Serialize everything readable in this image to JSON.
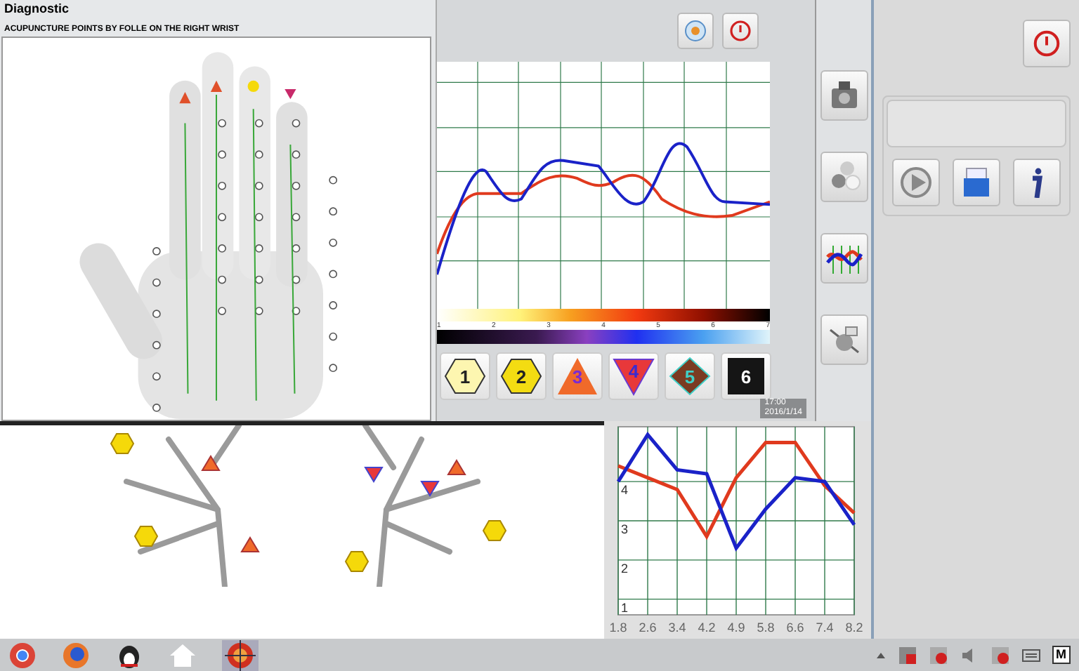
{
  "window": {
    "title": "Diagnostic"
  },
  "hand_panel": {
    "heading": "ACUPUNCTURE POINTS BY FOLLE ON THE RIGHT WRIST"
  },
  "scan_panel": {
    "scale_labels": [
      "1",
      "2",
      "3",
      "4",
      "5",
      "6",
      "7"
    ],
    "markers": [
      {
        "kind": "hexagon",
        "label": "1",
        "color": "#fdf6b0"
      },
      {
        "kind": "hexagon",
        "label": "2",
        "color": "#f3dc12"
      },
      {
        "kind": "triangle",
        "label": "3",
        "color": "#f06a2a"
      },
      {
        "kind": "inverted-triangle",
        "label": "4",
        "color": "#e8383a"
      },
      {
        "kind": "diamond",
        "label": "5",
        "color": "#7a3b22"
      },
      {
        "kind": "square",
        "label": "6",
        "color": "#151515"
      }
    ],
    "clock": {
      "time": "17:00",
      "date": "2016/1/14"
    }
  },
  "chart_panel": {
    "chart_data": {
      "type": "line",
      "grid": true,
      "x": [
        "1.8",
        "2.6",
        "3.4",
        "4.2",
        "4.9",
        "5.8",
        "6.6",
        "7.4",
        "8.2"
      ],
      "ylim": [
        0.6,
        5.4
      ],
      "yticks": [
        1,
        2,
        3,
        4
      ],
      "series": [
        {
          "color": "#e03a1e",
          "values": [
            4.4,
            4.1,
            3.8,
            2.6,
            4.1,
            5.0,
            5.0,
            3.9,
            3.2
          ]
        },
        {
          "color": "#1a22c8",
          "values": [
            4.0,
            5.2,
            4.3,
            4.2,
            2.3,
            3.3,
            4.1,
            4.0,
            2.9
          ]
        }
      ]
    }
  },
  "taskbar": {
    "tray_label": "M"
  }
}
